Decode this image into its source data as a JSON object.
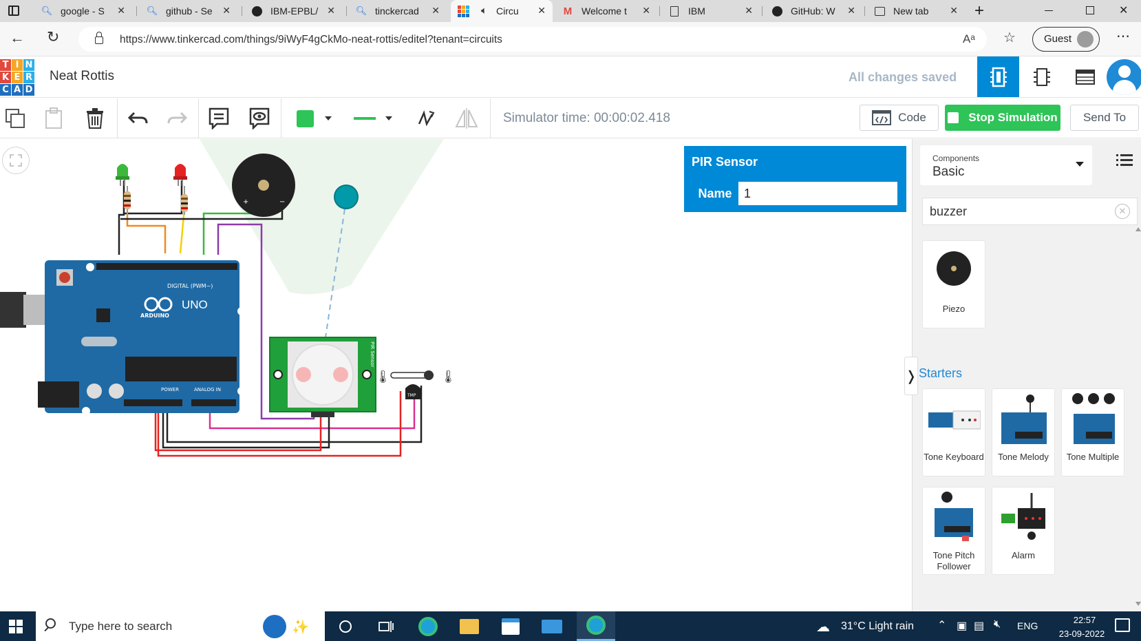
{
  "browser": {
    "tabs": [
      {
        "label": "google - S",
        "icon": "search-icon"
      },
      {
        "label": "github - Se",
        "icon": "search-icon"
      },
      {
        "label": "IBM-EPBL/",
        "icon": "github-icon"
      },
      {
        "label": "tinckercad",
        "icon": "search-icon"
      },
      {
        "label": "Circu",
        "icon": "tinkercad-icon",
        "active": true
      },
      {
        "label": "Welcome t",
        "icon": "gmail-icon"
      },
      {
        "label": "IBM",
        "icon": "page-icon"
      },
      {
        "label": "GitHub: W",
        "icon": "github-icon"
      },
      {
        "label": "New tab",
        "icon": "new-tab-icon"
      }
    ],
    "url": "https://www.tinkercad.com/things/9iWyF4gCkMo-neat-rottis/editel?tenant=circuits",
    "profile_label": "Guest"
  },
  "app": {
    "logo_letters": [
      "T",
      "I",
      "N",
      "K",
      "E",
      "R",
      "C",
      "A",
      "D"
    ],
    "logo_colors": [
      "#e2483c",
      "#f5a623",
      "#2bb0e8",
      "#e2483c",
      "#f5a623",
      "#2bb0e8",
      "#1f6fbf",
      "#1f6fbf",
      "#1f6fbf"
    ],
    "project_title": "Neat Rottis",
    "save_status": "All changes saved",
    "accent": "#0089d6"
  },
  "toolbar": {
    "simulator_time": "Simulator time: 00:00:02.418",
    "code_label": "Code",
    "stop_label": "Stop Simulation",
    "send_label": "Send To",
    "fill_color": "#2ec458"
  },
  "inspector": {
    "title": "PIR Sensor",
    "name_label": "Name",
    "name_value": "1"
  },
  "sidebar": {
    "components_caption": "Components",
    "components_value": "Basic",
    "search_value": "buzzer",
    "results": [
      {
        "label": "Piezo"
      }
    ],
    "starters_title": "Starters",
    "starters": [
      {
        "label": "Tone Keyboard"
      },
      {
        "label": "Tone Melody"
      },
      {
        "label": "Tone Multiple"
      },
      {
        "label": "Tone Pitch Follower"
      },
      {
        "label": "Alarm"
      }
    ]
  },
  "circuit": {
    "board_label_brand": "ARDUINO",
    "board_label_model": "UNO",
    "board_digital_label": "DIGITAL (PWM~)",
    "board_power_label": "POWER",
    "board_analog_label": "ANALOG IN",
    "sensor_label": "PIR Sensor",
    "tmp_label": "TMP"
  },
  "taskbar": {
    "search_placeholder": "Type here to search",
    "weather": "31°C  Light rain",
    "language": "ENG",
    "time": "22:57",
    "date": "23-09-2022"
  }
}
